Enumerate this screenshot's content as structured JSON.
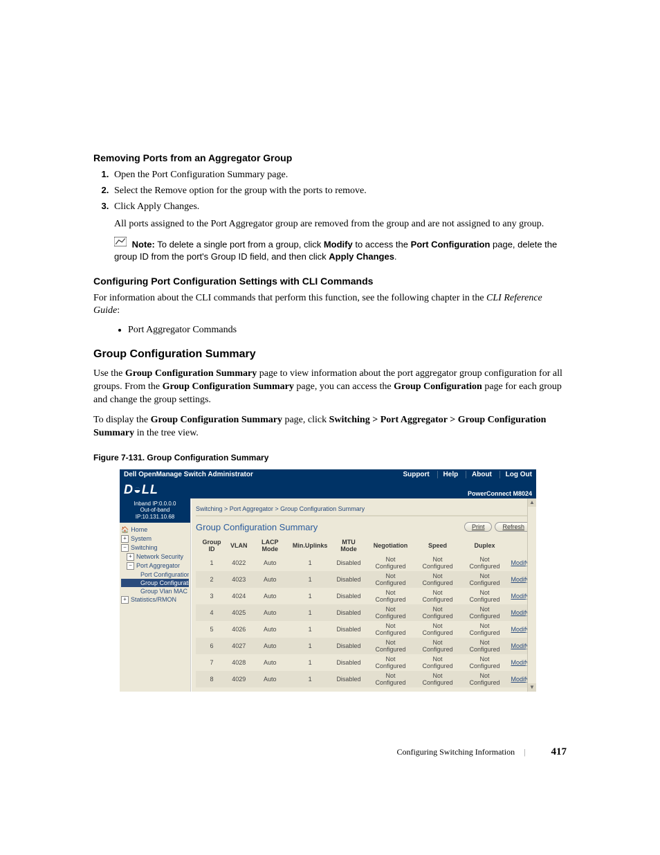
{
  "section1_title": "Removing Ports from an Aggregator Group",
  "steps": {
    "s1a": "Open the ",
    "s1b": "Port Configuration Summary",
    "s1c": " page.",
    "s2a": "Select the ",
    "s2b": "Remove",
    "s2c": " option for the group with the ports to remove.",
    "s3a": "Click ",
    "s3b": "Apply Changes",
    "s3c": "."
  },
  "after_steps": "All ports assigned to the Port Aggregator group are removed from the group and are not assigned to any group.",
  "note": {
    "label": "Note:",
    "t1": " To delete a single port from a group, click ",
    "b1": "Modify",
    "t2": " to access the ",
    "b2": "Port Configuration",
    "t3": " page, delete the group ID from the port's Group ID field, and then click ",
    "b3": "Apply Changes",
    "t4": "."
  },
  "section2_title": "Configuring Port Configuration Settings with CLI Commands",
  "cli_intro_a": "For information about the CLI commands that perform this function, see the following chapter in the ",
  "cli_intro_italic": "CLI Reference Guide",
  "cli_intro_b": ":",
  "bullet1": "Port Aggregator Commands",
  "h2": "Group Configuration Summary",
  "p1a": "Use the ",
  "p1b": "Group Configuration Summary",
  "p1c": " page to view information about the port aggregator group configuration for all groups. From the ",
  "p1d": "Group Configuration Summary",
  "p1e": " page, you can access the ",
  "p1f": "Group Configuration",
  "p1g": " page for each group and change the group settings.",
  "p2a": "To display the ",
  "p2b": "Group Configuration Summary",
  "p2c": " page, click ",
  "p2d": "Switching > Port Aggregator > Group Configuration Summary",
  "p2e": " in the tree view.",
  "figcap": "Figure 7-131.    Group Configuration Summary",
  "shot": {
    "topbar_title": "Dell OpenManage Switch Administrator",
    "topbar_links": [
      "Support",
      "Help",
      "About",
      "Log Out"
    ],
    "logo": "D◒LL",
    "model": "PowerConnect M8024",
    "ipbox_l1": "Inband IP:0.0.0.0",
    "ipbox_l2": "Out-of-band IP:10.131.10.68",
    "tree": {
      "home": "Home",
      "system": "System",
      "switching": "Switching",
      "netsec": "Network Security",
      "portagg": "Port Aggregator",
      "pcs": "Port Configuration S",
      "gcs": "Group Configurati",
      "gvm": "Group Vlan MAC Su",
      "stats": "Statistics/RMON"
    },
    "crumb": {
      "a": "Switching",
      "b": "Port Aggregator",
      "c": "Group Configuration Summary",
      "sep": " > "
    },
    "content_title": "Group Configuration Summary",
    "btn_print": "Print",
    "btn_refresh": "Refresh",
    "headers": [
      "Group ID",
      "VLAN",
      "LACP Mode",
      "Min.Uplinks",
      "MTU Mode",
      "Negotiation",
      "Speed",
      "Duplex",
      ""
    ],
    "rows": [
      {
        "id": "1",
        "vlan": "4022",
        "lacp": "Auto",
        "min": "1",
        "mtu": "Disabled",
        "neg": "Not Configured",
        "speed": "Not Configured",
        "dup": "Not Configured",
        "act": "Modify"
      },
      {
        "id": "2",
        "vlan": "4023",
        "lacp": "Auto",
        "min": "1",
        "mtu": "Disabled",
        "neg": "Not Configured",
        "speed": "Not Configured",
        "dup": "Not Configured",
        "act": "Modify"
      },
      {
        "id": "3",
        "vlan": "4024",
        "lacp": "Auto",
        "min": "1",
        "mtu": "Disabled",
        "neg": "Not Configured",
        "speed": "Not Configured",
        "dup": "Not Configured",
        "act": "Modify"
      },
      {
        "id": "4",
        "vlan": "4025",
        "lacp": "Auto",
        "min": "1",
        "mtu": "Disabled",
        "neg": "Not Configured",
        "speed": "Not Configured",
        "dup": "Not Configured",
        "act": "Modify"
      },
      {
        "id": "5",
        "vlan": "4026",
        "lacp": "Auto",
        "min": "1",
        "mtu": "Disabled",
        "neg": "Not Configured",
        "speed": "Not Configured",
        "dup": "Not Configured",
        "act": "Modify"
      },
      {
        "id": "6",
        "vlan": "4027",
        "lacp": "Auto",
        "min": "1",
        "mtu": "Disabled",
        "neg": "Not Configured",
        "speed": "Not Configured",
        "dup": "Not Configured",
        "act": "Modify"
      },
      {
        "id": "7",
        "vlan": "4028",
        "lacp": "Auto",
        "min": "1",
        "mtu": "Disabled",
        "neg": "Not Configured",
        "speed": "Not Configured",
        "dup": "Not Configured",
        "act": "Modify"
      },
      {
        "id": "8",
        "vlan": "4029",
        "lacp": "Auto",
        "min": "1",
        "mtu": "Disabled",
        "neg": "Not Configured",
        "speed": "Not Configured",
        "dup": "Not Configured",
        "act": "Modify"
      }
    ]
  },
  "footer_text": "Configuring Switching Information",
  "footer_sep": "|",
  "footer_page": "417"
}
